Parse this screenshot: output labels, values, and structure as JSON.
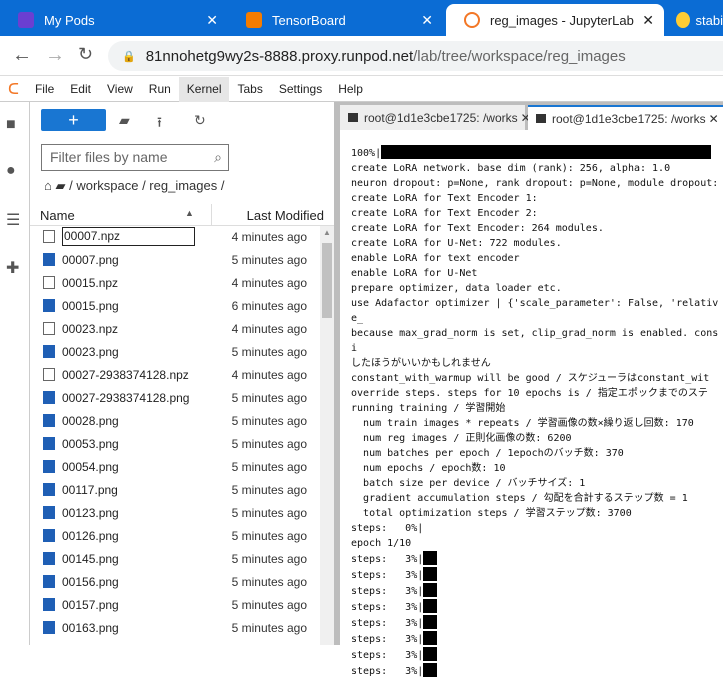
{
  "browser": {
    "tabs": [
      {
        "title": "My Pods"
      },
      {
        "title": "TensorBoard"
      },
      {
        "title": "reg_images - JupyterLab"
      },
      {
        "title": "stabi"
      }
    ],
    "url_host": "81nnohetg9wy2s-8888.proxy.runpod.net",
    "url_path": "/lab/tree/workspace/reg_images"
  },
  "menu": [
    "File",
    "Edit",
    "View",
    "Run",
    "Kernel",
    "Tabs",
    "Settings",
    "Help"
  ],
  "filebrowser": {
    "new_label": "+",
    "filter_placeholder": "Filter files by name",
    "breadcrumb": "/ workspace / reg_images /",
    "col_name": "Name",
    "col_modified": "Last Modified",
    "files": [
      {
        "name": "00007.npz",
        "type": "file",
        "modified": "4 minutes ago"
      },
      {
        "name": "00007.png",
        "type": "image",
        "modified": "5 minutes ago"
      },
      {
        "name": "00015.npz",
        "type": "file",
        "modified": "4 minutes ago"
      },
      {
        "name": "00015.png",
        "type": "image",
        "modified": "6 minutes ago"
      },
      {
        "name": "00023.npz",
        "type": "file",
        "modified": "4 minutes ago"
      },
      {
        "name": "00023.png",
        "type": "image",
        "modified": "5 minutes ago"
      },
      {
        "name": "00027-2938374128.npz",
        "type": "file",
        "modified": "4 minutes ago"
      },
      {
        "name": "00027-2938374128.png",
        "type": "image",
        "modified": "5 minutes ago"
      },
      {
        "name": "00028.png",
        "type": "image",
        "modified": "5 minutes ago"
      },
      {
        "name": "00053.png",
        "type": "image",
        "modified": "5 minutes ago"
      },
      {
        "name": "00054.png",
        "type": "image",
        "modified": "5 minutes ago"
      },
      {
        "name": "00117.png",
        "type": "image",
        "modified": "5 minutes ago"
      },
      {
        "name": "00123.png",
        "type": "image",
        "modified": "5 minutes ago"
      },
      {
        "name": "00126.png",
        "type": "image",
        "modified": "5 minutes ago"
      },
      {
        "name": "00145.png",
        "type": "image",
        "modified": "5 minutes ago"
      },
      {
        "name": "00156.png",
        "type": "image",
        "modified": "5 minutes ago"
      },
      {
        "name": "00157.png",
        "type": "image",
        "modified": "5 minutes ago"
      },
      {
        "name": "00163.png",
        "type": "image",
        "modified": "5 minutes ago"
      }
    ]
  },
  "terminal": {
    "tabs": [
      "root@1d1e3cbe1725: /works",
      "root@1d1e3cbe1725: /works"
    ],
    "lines": [
      "100%|",
      "create LoRA network. base dim (rank): 256, alpha: 1.0",
      "neuron dropout: p=None, rank dropout: p=None, module dropout:",
      "create LoRA for Text Encoder 1:",
      "create LoRA for Text Encoder 2:",
      "create LoRA for Text Encoder: 264 modules.",
      "create LoRA for U-Net: 722 modules.",
      "enable LoRA for text encoder",
      "enable LoRA for U-Net",
      "prepare optimizer, data loader etc.",
      "use Adafactor optimizer | {'scale_parameter': False, 'relative_",
      "because max_grad_norm is set, clip_grad_norm is enabled. consi",
      "したほうがいいかもしれません",
      "constant_with_warmup will be good / スケジューラはconstant_wit",
      "override steps. steps for 10 epochs is / 指定エポックまでのステ",
      "running training / 学習開始",
      "  num train images * repeats / 学習画像の数×繰り返し回数: 170",
      "  num reg images / 正則化画像の数: 6200",
      "  num batches per epoch / 1epochのバッチ数: 370",
      "  num epochs / epoch数: 10",
      "  batch size per device / バッチサイズ: 1",
      "  gradient accumulation steps / 勾配を合計するステップ数 = 1",
      "  total optimization steps / 学習ステップ数: 3700",
      "steps:   0%|",
      "epoch 1/10",
      "steps:   3%|",
      "steps:   3%|",
      "steps:   3%|",
      "steps:   3%|",
      "steps:   3%|",
      "steps:   3%|",
      "steps:   3%|",
      "steps:   3%|"
    ]
  }
}
